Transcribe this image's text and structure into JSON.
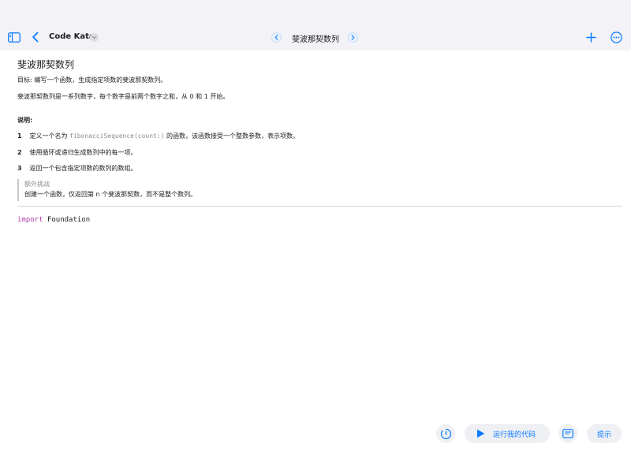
{
  "toolbar": {
    "icons": {
      "sidebar": "sidebar-toggle-icon",
      "back": "chevron-left-icon",
      "title_menu": "chevron-down-icon",
      "prev": "chevron-left-icon",
      "next": "chevron-right-icon",
      "add": "plus-icon",
      "more": "ellipsis-circle-icon"
    },
    "app_title": "Code Kata",
    "page_title": "斐波那契数列"
  },
  "doc": {
    "heading": "斐波那契数列",
    "goal": "目标: 编写一个函数，生成指定项数的斐波那契数列。",
    "intro": "斐波那契数列是一系列数字，每个数字是前两个数字之和，从 0 和 1 开始。",
    "notes_heading": "说明:",
    "steps": [
      {
        "num": "1",
        "before": "定义一个名为 ",
        "code": "fibonacciSequence(count:)",
        "after": " 的函数，该函数接受一个整数参数，表示项数。"
      },
      {
        "num": "2",
        "text": "使用循环或递归生成数列中的每一项。"
      },
      {
        "num": "3",
        "text": "返回一个包含指定项数的数列的数组。"
      }
    ],
    "challenge": {
      "title": "额外挑战",
      "body": "创建一个函数，仅返回第 n 个斐波那契数，而不是整个数列。"
    }
  },
  "editor": {
    "keyword": "import",
    "module": "Foundation"
  },
  "actions": {
    "run_label": "运行我的代码",
    "hint_label": "提示",
    "icons": {
      "timer": "timer-icon",
      "run": "play-icon",
      "docs": "text-page-icon"
    }
  },
  "colors": {
    "accent": "#0a7aff",
    "keyword": "#ad3da4",
    "chrome_bg": "#f2f2f7"
  }
}
